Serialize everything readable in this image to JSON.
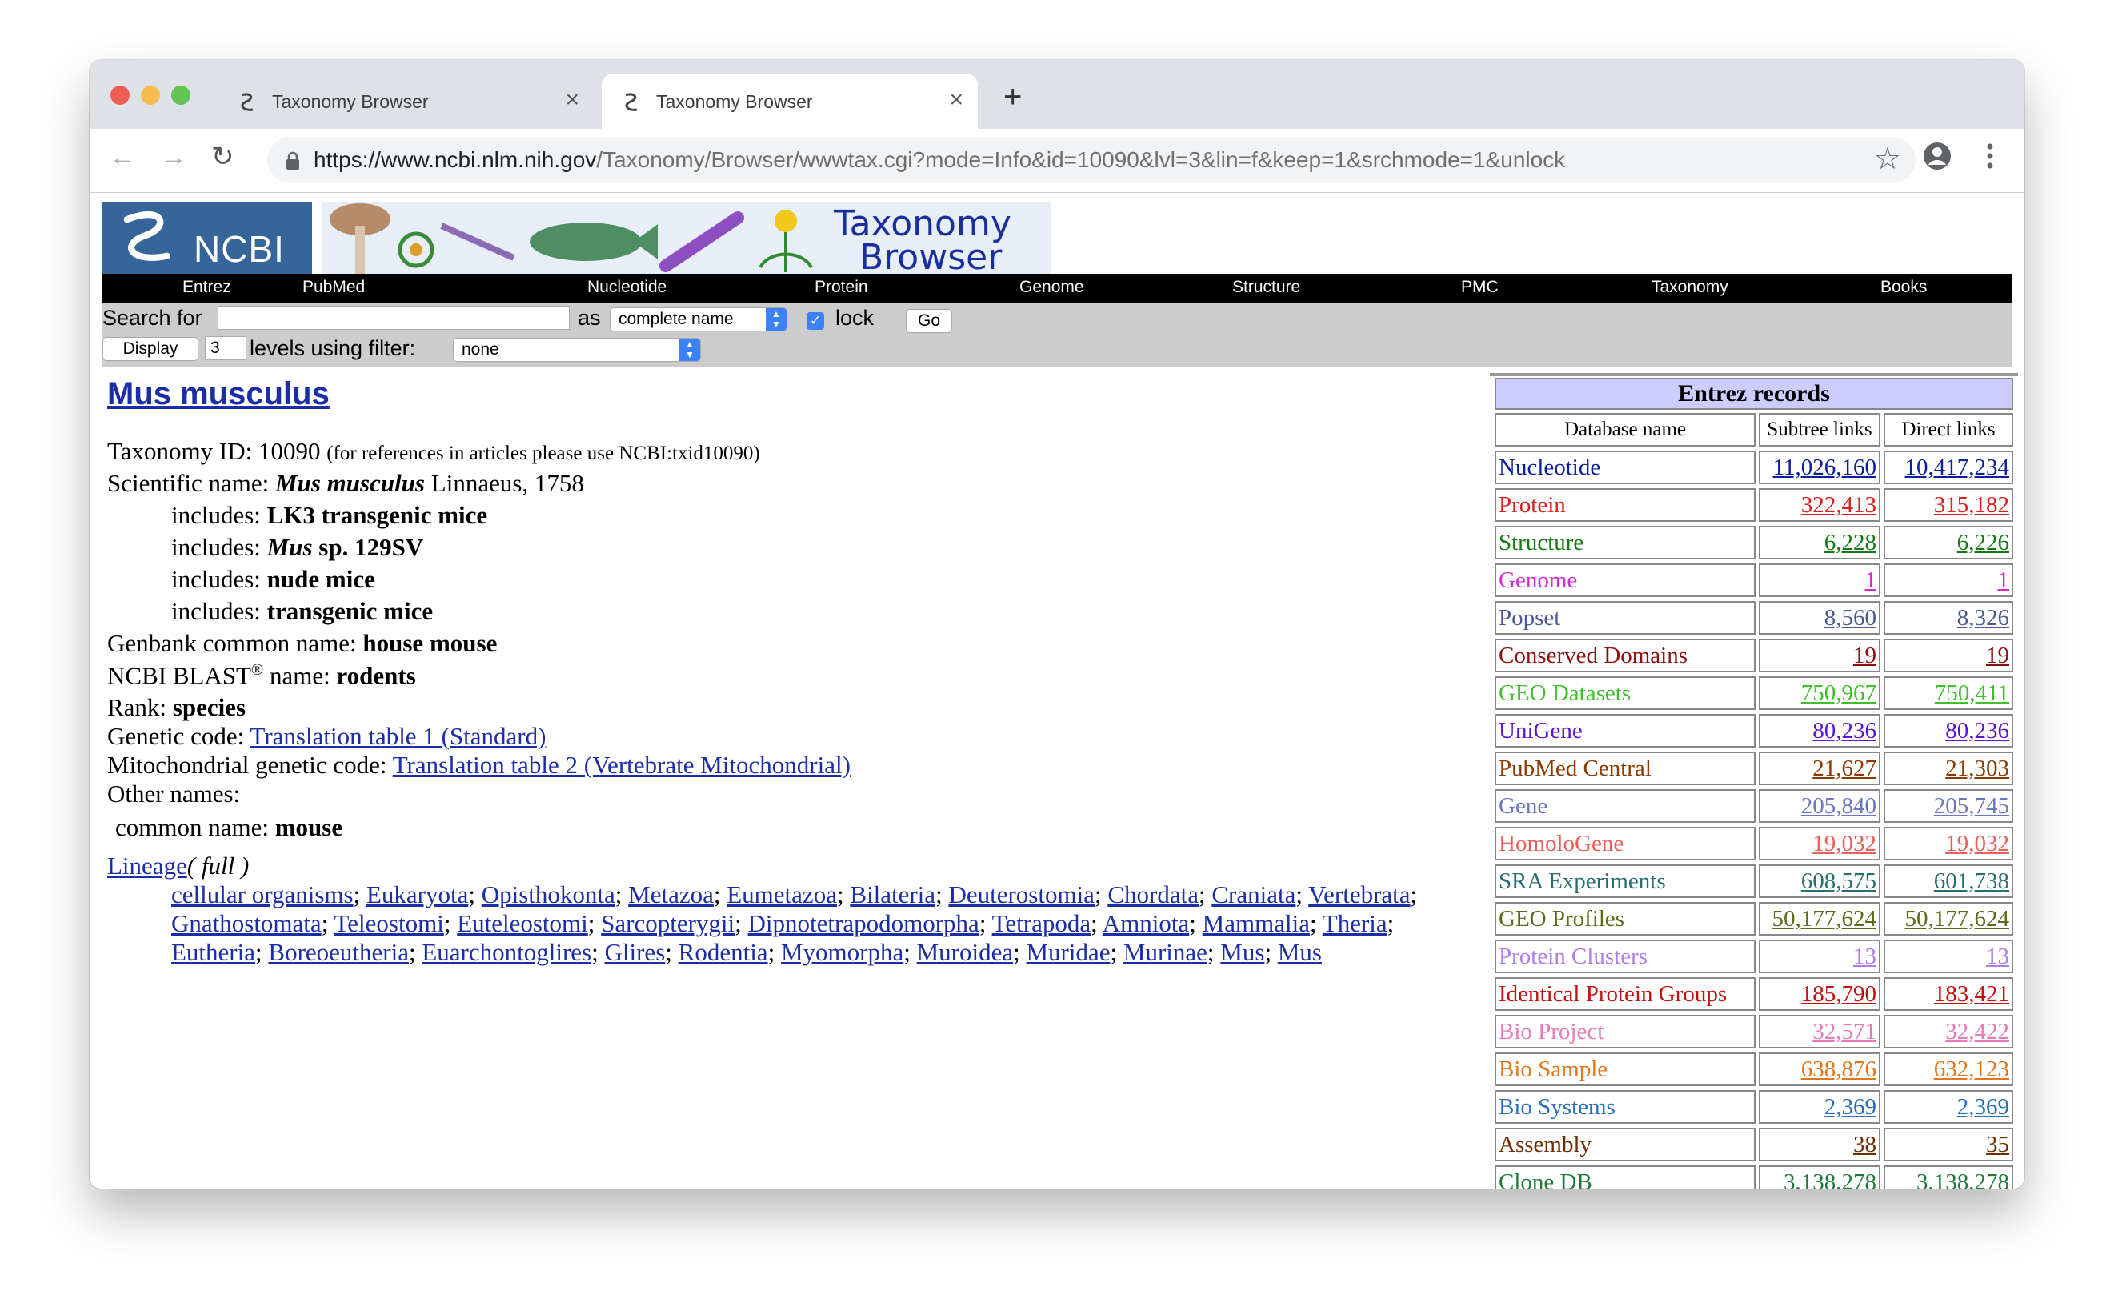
{
  "browser": {
    "tabs": [
      {
        "title": "Taxonomy Browser",
        "active": false
      },
      {
        "title": "Taxonomy Browser",
        "active": true
      }
    ],
    "url_host": "https://www.ncbi.nlm.nih.gov",
    "url_path": "/Taxonomy/Browser/wwwtax.cgi?mode=Info&id=10090&lvl=3&lin=f&keep=1&srchmode=1&unlock"
  },
  "header": {
    "logo_text": "NCBI",
    "banner_line1": "Taxonomy",
    "banner_line2": "Browser"
  },
  "nav": [
    "Entrez",
    "PubMed",
    "Nucleotide",
    "Protein",
    "Genome",
    "Structure",
    "PMC",
    "Taxonomy",
    "Books"
  ],
  "search": {
    "search_for_label": "Search for",
    "search_value": "",
    "as_label": "as",
    "as_selected": "complete name",
    "lock_label": "lock",
    "go_label": "Go",
    "display_label": "Display",
    "levels_value": "3",
    "levels_label": "levels using filter:",
    "filter_selected": "none"
  },
  "info": {
    "title": "Mus musculus",
    "taxonomy_id_label": "Taxonomy ID: 10090",
    "taxonomy_id_note": "(for references in articles please use NCBI:txid10090)",
    "scientific_name_label": "Scientific name:",
    "scientific_name": "Mus musculus",
    "scientific_name_authority": "Linnaeus, 1758",
    "includes_label": "includes:",
    "includes": [
      {
        "italic": "",
        "bold": "LK3 transgenic mice"
      },
      {
        "italic": "Mus",
        "bold": "sp. 129SV"
      },
      {
        "italic": "",
        "bold": "nude mice"
      },
      {
        "italic": "",
        "bold": "transgenic mice"
      }
    ],
    "genbank_label": "Genbank common name:",
    "genbank_value": "house mouse",
    "blast_label_pre": "NCBI BLAST",
    "blast_reg": "®",
    "blast_label_post": " name:",
    "blast_value": "rodents",
    "rank_label": "Rank:",
    "rank_value": "species",
    "genetic_code_label": "Genetic code:",
    "genetic_code_link": "Translation table 1 (Standard)",
    "mito_code_label": "Mitochondrial genetic code:",
    "mito_code_link": "Translation table 2 (Vertebrate Mitochondrial)",
    "other_names_label": "Other names:",
    "common_name_label": "common name:",
    "common_name_value": "mouse",
    "lineage_link": "Lineage",
    "lineage_mode": "( full )",
    "lineage_rows": [
      [
        "cellular organisms",
        "Eukaryota",
        "Opisthokonta",
        "Metazoa",
        "Eumetazoa",
        "Bilateria",
        "Deuterostomia",
        "Chordata",
        "Craniata",
        "Vertebrata"
      ],
      [
        "Gnathostomata",
        "Teleostomi",
        "Euteleostomi",
        "Sarcopterygii",
        "Dipnotetrapodomorpha",
        "Tetrapoda",
        "Amniota",
        "Mammalia",
        "Theria"
      ],
      [
        "Eutheria",
        "Boreoeutheria",
        "Euarchontoglires",
        "Glires",
        "Rodentia",
        "Myomorpha",
        "Muroidea",
        "Muridae",
        "Murinae",
        "Mus",
        "Mus"
      ]
    ]
  },
  "entrez": {
    "title": "Entrez records",
    "headers": [
      "Database name",
      "Subtree links",
      "Direct links"
    ],
    "rows": [
      {
        "name": "Nucleotide",
        "subtree": "11,026,160",
        "direct": "10,417,234",
        "color": "#0b1f9c"
      },
      {
        "name": "Protein",
        "subtree": "322,413",
        "direct": "315,182",
        "color": "#e01b1b"
      },
      {
        "name": "Structure",
        "subtree": "6,228",
        "direct": "6,226",
        "color": "#157a15"
      },
      {
        "name": "Genome",
        "subtree": "1",
        "direct": "1",
        "color": "#d12ad6"
      },
      {
        "name": "Popset",
        "subtree": "8,560",
        "direct": "8,326",
        "color": "#4b5b91"
      },
      {
        "name": "Conserved Domains",
        "subtree": "19",
        "direct": "19",
        "color": "#8b1010"
      },
      {
        "name": "GEO Datasets",
        "subtree": "750,967",
        "direct": "750,411",
        "color": "#3fbf2b"
      },
      {
        "name": "UniGene",
        "subtree": "80,236",
        "direct": "80,236",
        "color": "#5b14d6"
      },
      {
        "name": "PubMed Central",
        "subtree": "21,627",
        "direct": "21,303",
        "color": "#8a3a00"
      },
      {
        "name": "Gene",
        "subtree": "205,840",
        "direct": "205,745",
        "color": "#6b78c0"
      },
      {
        "name": "HomoloGene",
        "subtree": "19,032",
        "direct": "19,032",
        "color": "#e8605a"
      },
      {
        "name": "SRA Experiments",
        "subtree": "608,575",
        "direct": "601,738",
        "color": "#2a6e6e"
      },
      {
        "name": "GEO Profiles",
        "subtree": "50,177,624",
        "direct": "50,177,624",
        "color": "#5c6b1a"
      },
      {
        "name": "Protein Clusters",
        "subtree": "13",
        "direct": "13",
        "color": "#b07de8"
      },
      {
        "name": "Identical Protein Groups",
        "subtree": "185,790",
        "direct": "183,421",
        "color": "#c21010"
      },
      {
        "name": "Bio Project",
        "subtree": "32,571",
        "direct": "32,422",
        "color": "#e87ab8"
      },
      {
        "name": "Bio Sample",
        "subtree": "638,876",
        "direct": "632,123",
        "color": "#e2761b"
      },
      {
        "name": "Bio Systems",
        "subtree": "2,369",
        "direct": "2,369",
        "color": "#2a6fbf"
      },
      {
        "name": "Assembly",
        "subtree": "38",
        "direct": "35",
        "color": "#6b2e00"
      },
      {
        "name": "Clone DB",
        "subtree": "3,138,278",
        "direct": "3,138,278",
        "color": "#1f7a3a"
      }
    ]
  }
}
